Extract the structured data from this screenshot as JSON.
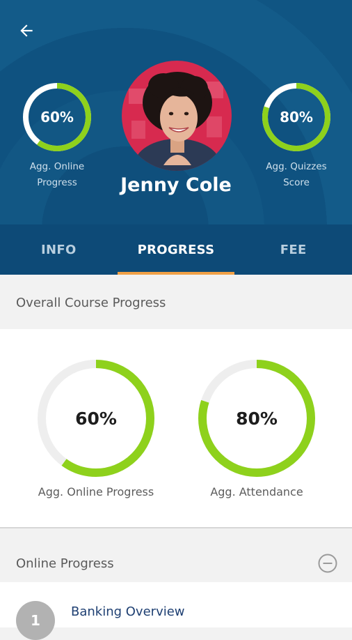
{
  "header": {
    "profile_name": "Jenny Cole",
    "left_stat": {
      "value": "60%",
      "fraction": 0.6,
      "label_line1": "Agg. Online",
      "label_line2": "Progress"
    },
    "right_stat": {
      "value": "80%",
      "fraction": 0.8,
      "label_line1": "Agg. Quizzes",
      "label_line2": "Score"
    }
  },
  "tabs": [
    {
      "label": "INFO",
      "active": false
    },
    {
      "label": "PROGRESS",
      "active": true
    },
    {
      "label": "FEE",
      "active": false
    }
  ],
  "overall": {
    "title": "Overall Course Progress",
    "stats": [
      {
        "value": "60%",
        "fraction": 0.6,
        "label": "Agg. Online Progress"
      },
      {
        "value": "80%",
        "fraction": 0.8,
        "label": "Agg. Attendance"
      }
    ]
  },
  "online": {
    "title": "Online Progress",
    "items": [
      {
        "number": "1",
        "title": "Banking Overview"
      }
    ]
  },
  "colors": {
    "header_bg": "#0f4f7c",
    "tab_bg": "#0d4a77",
    "tab_indicator": "#f0a046",
    "ring_progress": "#8ed11c",
    "ring_track_header": "#ffffff",
    "ring_track_body": "#eeeeee"
  }
}
